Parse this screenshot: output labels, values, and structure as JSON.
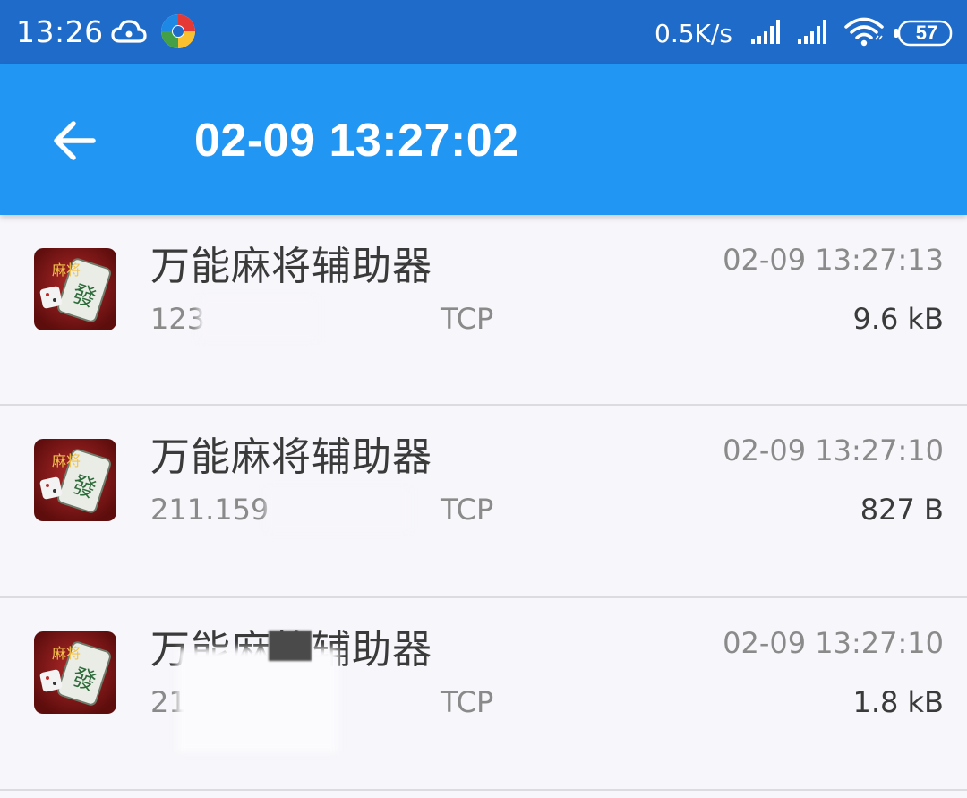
{
  "status_bar": {
    "time": "13:26",
    "net_speed": "0.5K/s",
    "battery_level": "57",
    "icons": [
      "cloud-icon",
      "app-notification-icon",
      "signal-icon",
      "signal-icon",
      "wifi-icon",
      "battery-icon"
    ]
  },
  "app_bar": {
    "title": "02-09 13:27:02",
    "back_icon": "arrow-left-icon",
    "color": "#2196f3"
  },
  "connections": [
    {
      "app_name": "万能麻将辅助器",
      "address": "123 1",
      "protocol": "TCP",
      "timestamp": "02-09 13:27:13",
      "size": "9.6 kB"
    },
    {
      "app_name": "万能麻将辅助器",
      "address": "211.159 0",
      "protocol": "TCP",
      "timestamp": "02-09 13:27:10",
      "size": "827 B"
    },
    {
      "app_name": "万能麻将辅助器",
      "address": "21 18:80",
      "protocol": "TCP",
      "timestamp": "02-09 13:27:10",
      "size": "1.8 kB"
    }
  ],
  "colors": {
    "status_bar": "#1f6bc9",
    "app_bar": "#2196f3",
    "background": "#f7f6fa"
  }
}
